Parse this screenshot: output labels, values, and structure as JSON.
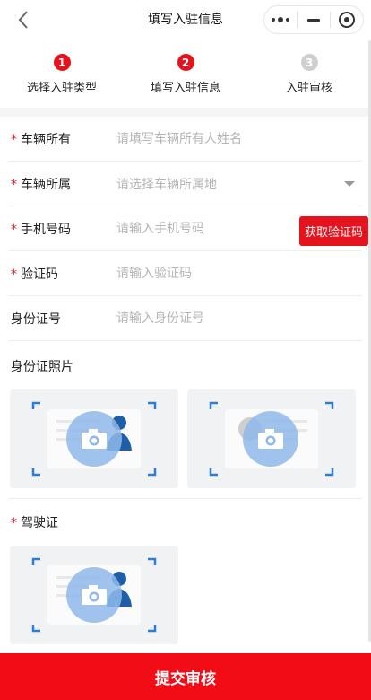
{
  "nav": {
    "title": "填写入驻信息"
  },
  "steps": [
    {
      "num": "1",
      "label": "选择入驻类型",
      "state": "done"
    },
    {
      "num": "2",
      "label": "填写入驻信息",
      "state": "active"
    },
    {
      "num": "3",
      "label": "入驻审核",
      "state": "pending"
    }
  ],
  "form": {
    "owner": {
      "label": "车辆所有",
      "placeholder": "请填写车辆所有人姓名",
      "required": true
    },
    "location": {
      "label": "车辆所属",
      "placeholder": "请选择车辆所属地",
      "required": true
    },
    "phone": {
      "label": "手机号码",
      "placeholder": "请输入手机号码",
      "required": true,
      "code_button": "获取验证码"
    },
    "code": {
      "label": "验证码",
      "placeholder": "请输入验证码",
      "required": true
    },
    "id_number": {
      "label": "身份证号",
      "placeholder": "请输入身份证号",
      "required": false
    }
  },
  "id_photo": {
    "title": "身份证照片"
  },
  "license": {
    "title": "驾驶证",
    "required": true
  },
  "submit_label": "提交审核",
  "required_mark": "*",
  "colors": {
    "accent": "#e5131d",
    "submit": "#f20c16",
    "placeholder": "#b5b5b5",
    "upload_bg": "#f1f2f4",
    "corner": "#2d7fd3"
  },
  "icons": [
    "back-arrow-icon",
    "more-dots-icon",
    "minimize-icon",
    "close-target-icon",
    "dropdown-caret-icon",
    "camera-icon",
    "person-icon"
  ]
}
